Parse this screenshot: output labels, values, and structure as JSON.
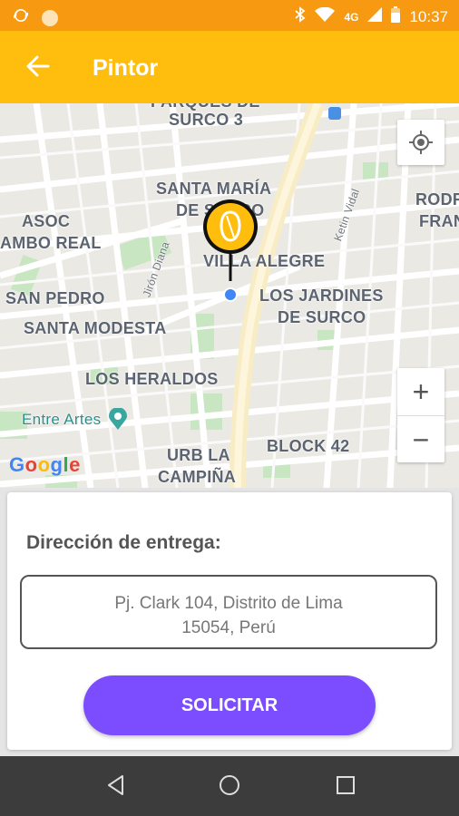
{
  "status_bar": {
    "network": "4G",
    "time": "10:37"
  },
  "app_bar": {
    "title": "Pintor"
  },
  "map": {
    "labels": {
      "parques": "PARQUES DE",
      "surco3": "SURCO 3",
      "santa_maria_1": "SANTA MARÍA",
      "santa_maria_2": "DE SURCO",
      "asoc": "ASOC",
      "cambo_real": "AMBO REAL",
      "villa_alegre": "VILLA ALEGRE",
      "san_pedro": "SAN PEDRO",
      "jardines_1": "LOS JARDINES",
      "jardines_2": "DE SURCO",
      "santa_modesta": "SANTA MODESTA",
      "heraldos": "LOS HERALDOS",
      "entre_artes": "Entre Artes",
      "urb_la": "URB LA",
      "campina": "CAMPIÑA",
      "block42": "BLOCK 42",
      "rodr": "RODR",
      "fran": "FRAN",
      "jiron_diana": "Jirón Diana",
      "ketin_vidal": "Ketin Vidal"
    },
    "attribution": "Google",
    "zoom_in": "+",
    "zoom_out": "−"
  },
  "delivery": {
    "label": "Dirección de entrega:",
    "address_line1": "Pj. Clark 104, Distrito de Lima",
    "address_line2": "15054, Perú",
    "submit_label": "SOLICITAR"
  },
  "colors": {
    "status_bar": "#f79a12",
    "app_bar": "#ffbd0d",
    "button": "#7c4dff",
    "pin": "#ffbd0d",
    "nav_bar": "#3c3c3c"
  }
}
